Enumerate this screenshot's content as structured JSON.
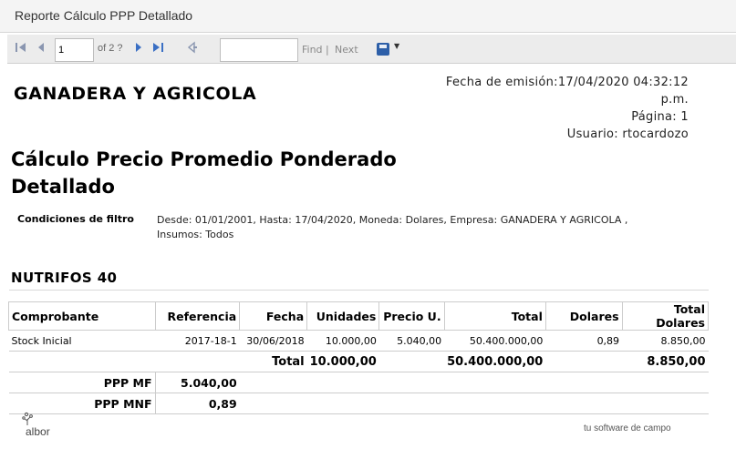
{
  "window": {
    "title": "Reporte Cálculo PPP Detallado"
  },
  "toolbar": {
    "page_value": "1",
    "of_text": "of 2 ?",
    "find_placeholder": "",
    "find_label": "Find",
    "separator": "|",
    "next_label": "Next"
  },
  "header": {
    "company": "GANADERA Y AGRICOLA",
    "emission": "Fecha de emisión:17/04/2020 04:32:12",
    "emission_suffix": "p.m.",
    "page": "Página: 1",
    "user": "Usuario: rtocardozo"
  },
  "report": {
    "title_line1": "Cálculo Precio Promedio Ponderado",
    "title_line2": "Detallado"
  },
  "filters": {
    "label": "Condiciones de filtro",
    "line1": "Desde: 01/01/2001, Hasta: 17/04/2020, Moneda: Dolares, Empresa: GANADERA Y AGRICOLA ,",
    "line2": "Insumos: Todos"
  },
  "section": {
    "name": "NUTRIFOS 40"
  },
  "table": {
    "columns": [
      "Comprobante",
      "Referencia",
      "Fecha",
      "Unidades",
      "Precio U.",
      "Total",
      "Dolares",
      "Total Dolares"
    ],
    "rows": [
      [
        "Stock Inicial",
        "2017-18-1",
        "30/06/2018",
        "10.000,00",
        "5.040,00",
        "50.400.000,00",
        "0,89",
        "8.850,00"
      ]
    ],
    "total_label": "Total",
    "total_unidades": "10.000,00",
    "total_total": "50.400.000,00",
    "total_dolares": "8.850,00",
    "ppp_mf_label": "PPP MF",
    "ppp_mf_value": "5.040,00",
    "ppp_mnf_label": "PPP MNF",
    "ppp_mnf_value": "0,89"
  },
  "footer": {
    "logo_text": "albor",
    "tagline": "tu software de campo"
  },
  "colors": {
    "accent": "#2d5fa8",
    "nav_icons": "#7a8aa8"
  },
  "icons": [
    "first-page-icon",
    "prev-page-icon",
    "next-page-icon",
    "last-page-icon",
    "back-icon",
    "save-icon",
    "dropdown-icon"
  ]
}
